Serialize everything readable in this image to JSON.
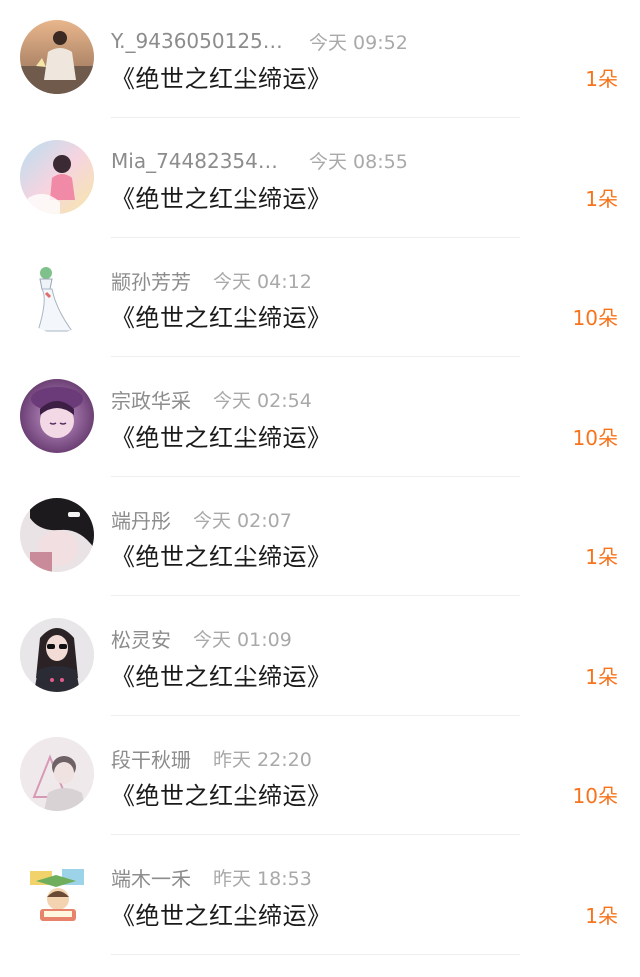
{
  "accent_color": "#f7741d",
  "items": [
    {
      "username": "Y._94360501259...",
      "time": "今天 09:52",
      "title": "《绝世之红尘缔运》",
      "gift": "1朵",
      "avatar_icon": "avatar-girl-sunset-icon"
    },
    {
      "username": "Mia_744823542...",
      "time": "今天 08:55",
      "title": "《绝世之红尘缔运》",
      "gift": "1朵",
      "avatar_icon": "avatar-pastel-girl-icon"
    },
    {
      "username": "颛孙芳芳",
      "time": "今天 04:12",
      "title": "《绝世之红尘缔运》",
      "gift": "10朵",
      "avatar_icon": "avatar-gardevoir-icon"
    },
    {
      "username": "宗政华采",
      "time": "今天 02:54",
      "title": "《绝世之红尘缔运》",
      "gift": "10朵",
      "avatar_icon": "avatar-anime-girl-purple-icon"
    },
    {
      "username": "端丹彤",
      "time": "今天 02:07",
      "title": "《绝世之红尘缔运》",
      "gift": "1朵",
      "avatar_icon": "avatar-girl-hairclip-icon"
    },
    {
      "username": "松灵安",
      "time": "今天 01:09",
      "title": "《绝世之红尘缔运》",
      "gift": "1朵",
      "avatar_icon": "avatar-girl-sunglasses-icon"
    },
    {
      "username": "段干秋珊",
      "time": "昨天 22:20",
      "title": "《绝世之红尘缔运》",
      "gift": "10朵",
      "avatar_icon": "avatar-boy-triangle-icon"
    },
    {
      "username": "端木一禾",
      "time": "昨天 18:53",
      "title": "《绝世之红尘缔运》",
      "gift": "1朵",
      "avatar_icon": "avatar-cartoon-reader-icon"
    }
  ]
}
